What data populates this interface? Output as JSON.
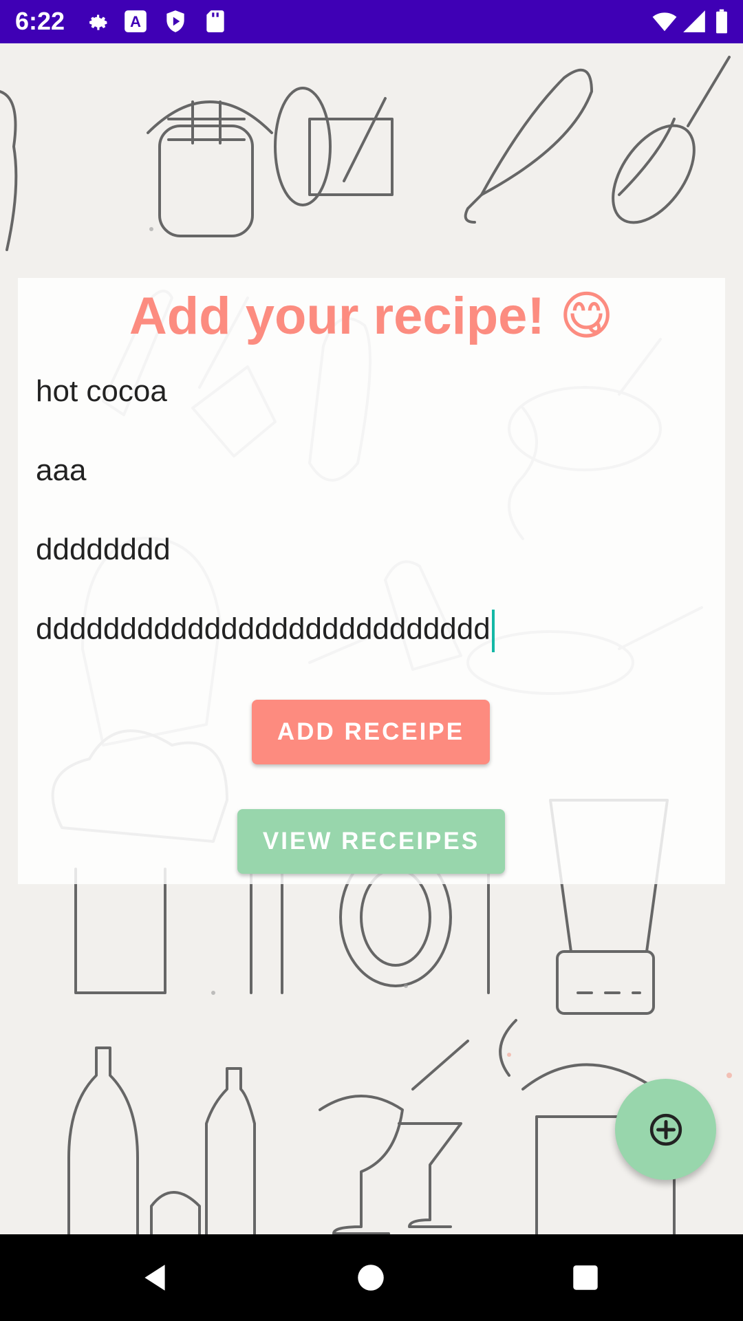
{
  "status_bar": {
    "time": "6:22",
    "left_icons": [
      "gear-icon",
      "a-font-icon",
      "shield-icon",
      "sd-card-icon"
    ],
    "right_icons": [
      "wifi-icon",
      "cell-signal-icon",
      "battery-icon"
    ]
  },
  "screen": {
    "title": "Add your recipe! 😋",
    "fields": [
      {
        "value": "hot cocoa"
      },
      {
        "value": "aaa"
      },
      {
        "value": "dddddddd"
      },
      {
        "value": "ddddddddddddddddddddddddddd"
      }
    ],
    "add_button_label": "ADD RECEIPE",
    "view_button_label": "VIEW RECEIPES",
    "fab_icon": "plus-circle-icon"
  },
  "nav_bar": {
    "icons": [
      "back-icon",
      "home-icon",
      "recents-icon"
    ]
  },
  "colors": {
    "status_bar": "#3f00b5",
    "title": "#fc8c80",
    "add_button": "#fd8b7f",
    "view_button": "#98d6ac",
    "fab": "#98d6ac",
    "cursor": "#14b8a6"
  }
}
